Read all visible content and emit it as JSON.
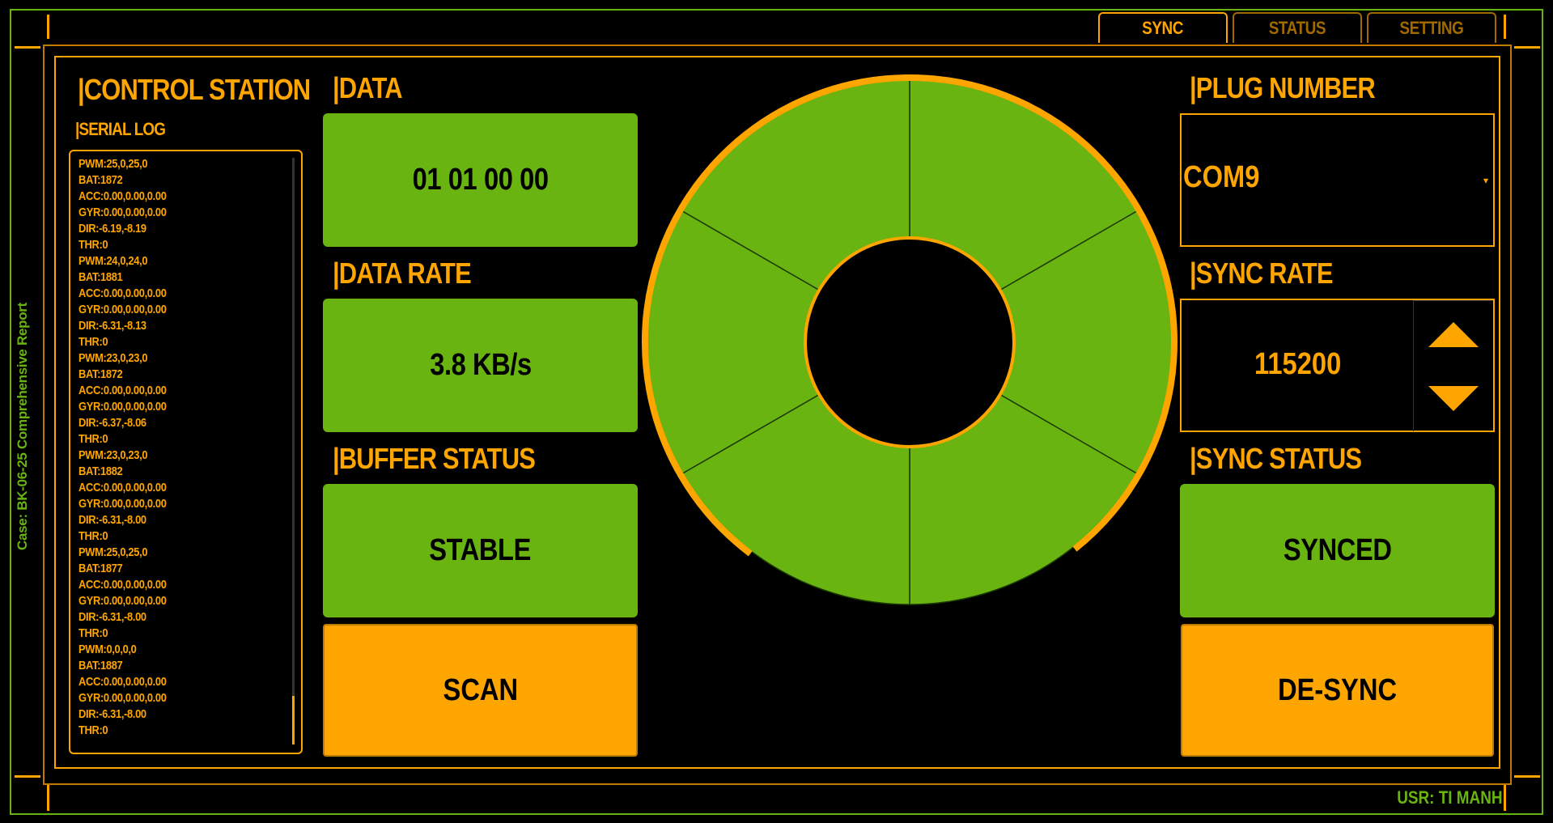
{
  "tabs": [
    {
      "label": "SYNC",
      "active": true
    },
    {
      "label": "STATUS",
      "active": false
    },
    {
      "label": "SETTING",
      "active": false
    }
  ],
  "sidebar_caption": "Case: BK-06-25 Comprehensive Report",
  "control_station": {
    "title": "|CONTROL STATION",
    "serial_log_title": "|SERIAL LOG",
    "serial_log_lines": [
      "PWM:25,0,25,0",
      "BAT:1872",
      "ACC:0.00,0.00,0.00",
      "GYR:0.00,0.00,0.00",
      "DIR:-6.19,-8.19",
      "THR:0",
      "PWM:24,0,24,0",
      "BAT:1881",
      "ACC:0.00,0.00,0.00",
      "GYR:0.00,0.00,0.00",
      "DIR:-6.31,-8.13",
      "THR:0",
      "PWM:23,0,23,0",
      "BAT:1872",
      "ACC:0.00,0.00,0.00",
      "GYR:0.00,0.00,0.00",
      "DIR:-6.37,-8.06",
      "THR:0",
      "PWM:23,0,23,0",
      "BAT:1882",
      "ACC:0.00,0.00,0.00",
      "GYR:0.00,0.00,0.00",
      "DIR:-6.31,-8.00",
      "THR:0",
      "PWM:25,0,25,0",
      "BAT:1877",
      "ACC:0.00,0.00,0.00",
      "GYR:0.00,0.00,0.00",
      "DIR:-6.31,-8.00",
      "THR:0",
      "PWM:0,0,0,0",
      "BAT:1887",
      "ACC:0.00,0.00,0.00",
      "GYR:0.00,0.00,0.00",
      "DIR:-6.31,-8.00",
      "THR:0"
    ]
  },
  "data_panel": {
    "data_title": "|DATA",
    "data_value": "01 01 00 00",
    "rate_title": "|DATA RATE",
    "rate_value": "3.8 KB/s",
    "buffer_title": "|BUFFER STATUS",
    "buffer_value": "STABLE",
    "scan_button": "SCAN"
  },
  "gauge": {
    "segments": 6,
    "fill_color": "#6ab412",
    "accent_color": "#ffa500",
    "progress_fraction": 0.79
  },
  "right_panel": {
    "plug_title": "|PLUG NUMBER",
    "plug_value": "COM9",
    "sync_rate_title": "|SYNC RATE",
    "sync_rate_value": "115200",
    "sync_status_title": "|SYNC STATUS",
    "sync_status_value": "SYNCED",
    "desync_button": "DE-SYNC"
  },
  "user_label": "USR: TI MANH",
  "colors": {
    "background": "#000000",
    "green": "#6ab412",
    "orange": "#ffa500"
  }
}
